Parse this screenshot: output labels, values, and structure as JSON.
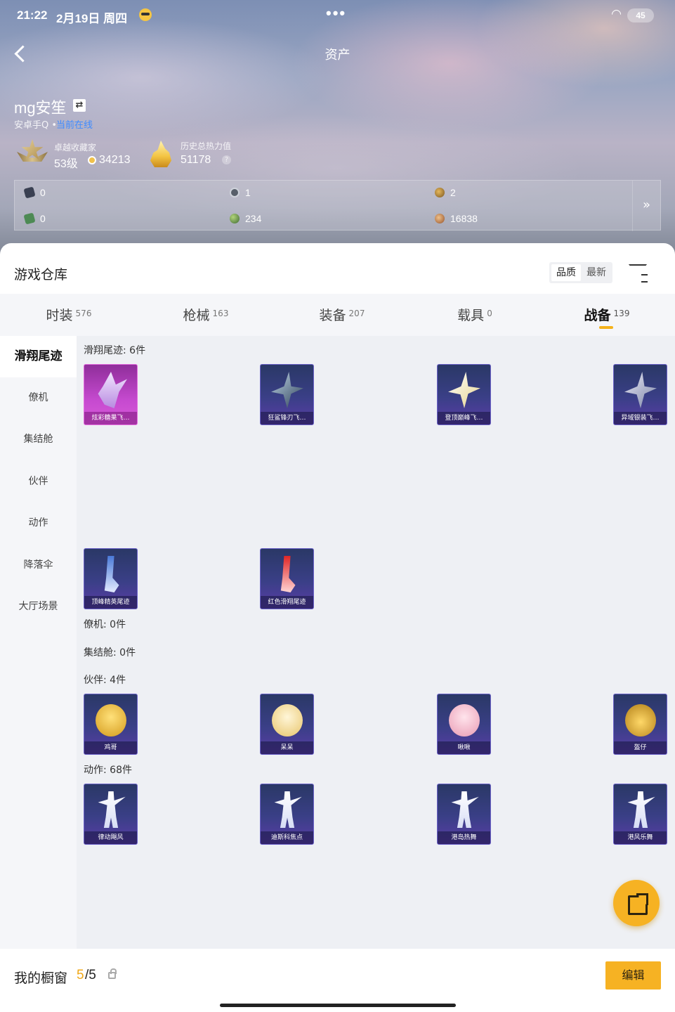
{
  "status_bar": {
    "time": "21:22",
    "date": "2月19日 周四",
    "dots": "•••",
    "battery": "45"
  },
  "header": {
    "title": "资产",
    "player_name": "mg安笙",
    "swap_icon": "⇄",
    "platform": "安卓手Q •",
    "online_status": "当前在线",
    "collector_label": "卓越收藏家",
    "collector_level": "53级",
    "collector_points": "34213",
    "power_label": "历史总热力值",
    "power_value": "51178",
    "help": "?"
  },
  "currencies": [
    {
      "icon": "card-dark-icon",
      "value": "0"
    },
    {
      "icon": "gear-coin-icon",
      "value": "1"
    },
    {
      "icon": "gold-coin-icon",
      "value": "2"
    },
    {
      "icon": "card-green-icon",
      "value": "0"
    },
    {
      "icon": "green-sphere-icon",
      "value": "234"
    },
    {
      "icon": "copper-coin-icon",
      "value": "16838"
    }
  ],
  "currency_more": "»",
  "warehouse": {
    "title": "游戏仓库",
    "sort_quality": "品质",
    "sort_newest": "最新"
  },
  "tabs": [
    {
      "label": "时装",
      "count": "576"
    },
    {
      "label": "枪械",
      "count": "163"
    },
    {
      "label": "装备",
      "count": "207"
    },
    {
      "label": "载具",
      "count": "0"
    },
    {
      "label": "战备",
      "count": "139",
      "active": true
    }
  ],
  "side_nav": [
    "滑翔尾迹",
    "僚机",
    "集结舱",
    "伙伴",
    "动作",
    "降落伞",
    "大厅场景"
  ],
  "sections": {
    "glide": {
      "label": "滑翔尾迹: 6件",
      "items": [
        "炫彩糖果飞…",
        "狂鲨锋刃飞…",
        "登顶巅峰飞…",
        "异域银装飞…",
        "顶峰精英尾迹",
        "红色滑翔尾迹"
      ]
    },
    "wingman": {
      "label": "僚机: 0件"
    },
    "pod": {
      "label": "集结舱: 0件"
    },
    "partner": {
      "label": "伙伴: 4件",
      "items": [
        "鸡哥",
        "呆呆",
        "啾啾",
        "盔仔"
      ]
    },
    "emote": {
      "label": "动作: 68件",
      "items": [
        "律动飓风",
        "迪斯科焦点",
        "港岛热舞",
        "港风乐舞"
      ]
    }
  },
  "showcase": {
    "label": "我的橱窗",
    "current": "5",
    "total": "/5",
    "edit": "编辑"
  },
  "colors": {
    "accent": "#f6b223",
    "rare_purple": "#3a3f87",
    "legendary_pink": "#c64ad0"
  }
}
